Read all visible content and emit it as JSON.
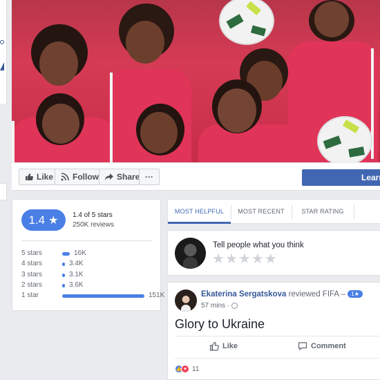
{
  "actionbar": {
    "like_label": "Like",
    "follow_label": "Follow",
    "share_label": "Share",
    "more_label": "···",
    "learn_label": "Learn"
  },
  "rating": {
    "score": "1.4",
    "summary": "1.4 of 5 stars",
    "reviews": "250K reviews",
    "distribution": [
      {
        "label": "5 stars",
        "count": "16K",
        "fraction": 0.09
      },
      {
        "label": "4 stars",
        "count": "3.4K",
        "fraction": 0.02
      },
      {
        "label": "3 stars",
        "count": "3.1K",
        "fraction": 0.02
      },
      {
        "label": "2 stars",
        "count": "3.6K",
        "fraction": 0.02
      },
      {
        "label": "1 star",
        "count": "151K",
        "fraction": 1.0
      }
    ]
  },
  "tabs": {
    "most_helpful": "MOST HELPFUL",
    "most_recent": "MOST RECENT",
    "star_rating": "STAR RATING"
  },
  "composer": {
    "prompt": "Tell people what you think"
  },
  "review": {
    "author": "Ekaterina Sergatskova",
    "action": "reviewed FIFA –",
    "badge": "1★",
    "time": "57 mins ·",
    "text": "Glory to Ukraine",
    "like_label": "Like",
    "comment_label": "Comment",
    "reaction_count": "11"
  },
  "colors": {
    "accent": "#4267b2",
    "rating_pill": "#4a7fe6",
    "jersey": "#e03458"
  }
}
